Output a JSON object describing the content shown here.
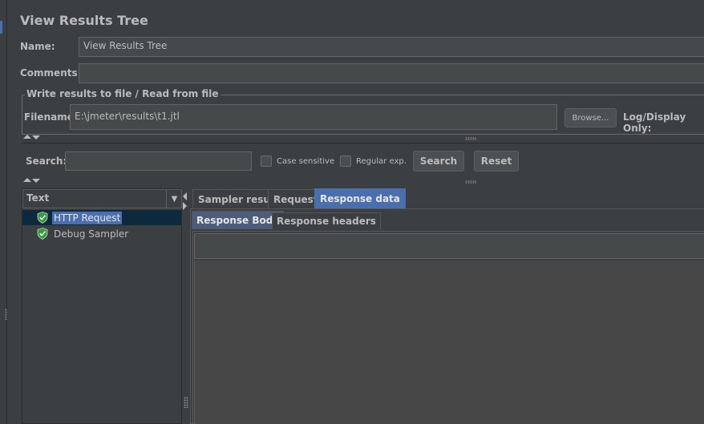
{
  "panel": {
    "title": "View Results Tree"
  },
  "form": {
    "name_label": "Name:",
    "name_value": "View Results Tree",
    "comments_label": "Comments:",
    "comments_value": ""
  },
  "file_group": {
    "title": "Write results to file / Read from file",
    "filename_label": "Filename",
    "filename_value": "E:\\jmeter\\results\\t1.jtl",
    "browse_label": "Browse...",
    "log_display_label": "Log/Display Only:"
  },
  "search": {
    "label": "Search:",
    "value": "",
    "case_sensitive_label": "Case sensitive",
    "regex_label": "Regular exp.",
    "search_button": "Search",
    "reset_button": "Reset"
  },
  "tree": {
    "renderer_selected": "Text",
    "items": [
      {
        "label": "HTTP Request",
        "status": "success",
        "selected": true
      },
      {
        "label": "Debug Sampler",
        "status": "success",
        "selected": false
      }
    ]
  },
  "result_tabs": [
    {
      "label": "Sampler result",
      "active": false
    },
    {
      "label": "Request",
      "active": false
    },
    {
      "label": "Response data",
      "active": true
    }
  ],
  "response_tabs": [
    {
      "label": "Response Body",
      "active": true
    },
    {
      "label": "Response headers",
      "active": false
    }
  ],
  "colors": {
    "background": "#3c3f41",
    "accent": "#4b6eaf",
    "field": "#45494a",
    "success_icon": "#2e9e3a"
  },
  "icons": {
    "success": "shield-check-icon",
    "combo": "chevron-down-icon"
  }
}
